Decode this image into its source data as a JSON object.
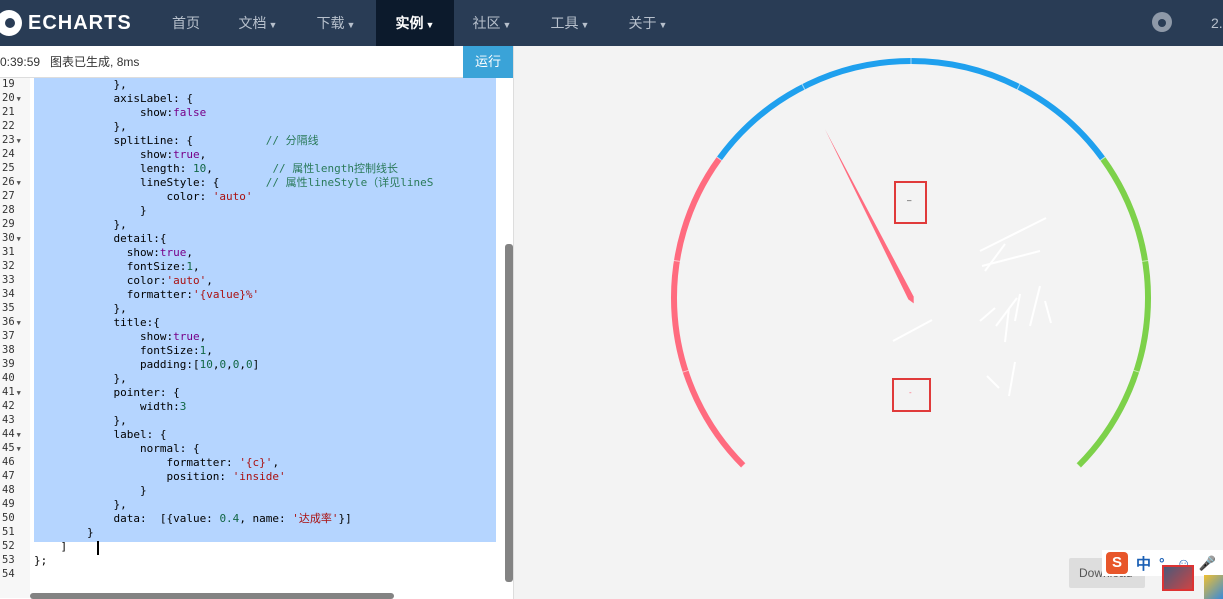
{
  "nav": {
    "logo": "ECHARTS",
    "items": [
      {
        "label": "首页",
        "dropdown": false
      },
      {
        "label": "文档",
        "dropdown": true
      },
      {
        "label": "下载",
        "dropdown": true
      },
      {
        "label": "实例",
        "dropdown": true,
        "active": true
      },
      {
        "label": "社区",
        "dropdown": true
      },
      {
        "label": "工具",
        "dropdown": true
      },
      {
        "label": "关于",
        "dropdown": true
      }
    ],
    "github_icon": "github-icon",
    "version": "2."
  },
  "status": {
    "time": "0:39:59",
    "message": "图表已生成, 8ms",
    "run_label": "运行"
  },
  "code": {
    "line_numbers": [
      "19",
      "20",
      "21",
      "22",
      "23",
      "24",
      "25",
      "26",
      "27",
      "28",
      "29",
      "30",
      "31",
      "32",
      "33",
      "34",
      "35",
      "36",
      "37",
      "38",
      "39",
      "40",
      "41",
      "42",
      "43",
      "44",
      "45",
      "46",
      "47",
      "48",
      "49",
      "50",
      "51",
      "52",
      "53",
      "54"
    ],
    "folded_lines": [
      "20",
      "23",
      "26",
      "30",
      "36",
      "41",
      "44",
      "45"
    ],
    "lines": [
      "            },",
      "            axisLabel: {",
      "                show:false",
      "            },",
      "            splitLine: {           // 分隔线",
      "                show:true,",
      "                length: 10,         // 属性length控制线长",
      "                lineStyle: {       // 属性lineStyle（详见lineS",
      "                    color: 'auto'",
      "                }",
      "            },",
      "            detail:{",
      "              show:true,",
      "              fontSize:1,",
      "              color:'auto',",
      "              formatter:'{value}%'",
      "            },",
      "            title:{",
      "                show:true,",
      "                fontSize:1,",
      "                padding:[10,0,0,0]",
      "            },",
      "            pointer: {",
      "                width:3",
      "            },",
      "            label: {",
      "                normal: {",
      "                    formatter: '{c}',",
      "                    position: 'inside'",
      "                }",
      "            },",
      "            data:  [{value: 0.4, name: '达成率'}]",
      "        }",
      "    ]",
      "};",
      ""
    ]
  },
  "gauge": {
    "value": 0.4,
    "name": "达成率",
    "color_ranges": [
      {
        "to": 0.3,
        "color": "#ff6b7f"
      },
      {
        "to": 0.7,
        "color": "#1fa0ee"
      },
      {
        "to": 1.0,
        "color": "#7dd14a"
      }
    ],
    "pointer_color": "#ff6b7f",
    "title_text": "–",
    "detail_text": "-"
  },
  "download_label": "Download",
  "ime": {
    "logo": "S",
    "lang": "中",
    "icons": [
      "punctuation-icon",
      "emoji-icon",
      "microphone-icon"
    ]
  }
}
